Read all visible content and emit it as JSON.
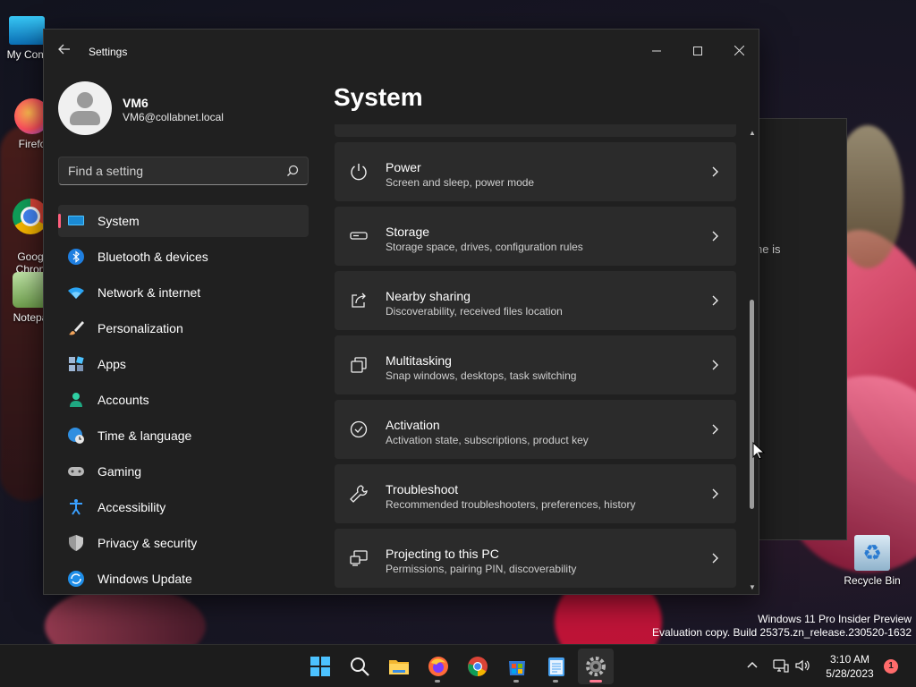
{
  "desktop": {
    "icons": [
      {
        "label": "My Com"
      },
      {
        "label": "Firefo"
      },
      {
        "label": "Goog\nChron"
      },
      {
        "label": "Notepa"
      },
      {
        "label": "Recycle Bin"
      }
    ],
    "background_window_partial_text": "ne is"
  },
  "window": {
    "title": "Settings",
    "controls": {
      "minimize": "—",
      "maximize": "☐",
      "close": "✕"
    }
  },
  "profile": {
    "name": "VM6",
    "email": "VM6@collabnet.local"
  },
  "search": {
    "placeholder": "Find a setting"
  },
  "nav": {
    "items": [
      {
        "label": "System",
        "icon": "monitor-icon",
        "active": true
      },
      {
        "label": "Bluetooth & devices",
        "icon": "bluetooth-icon"
      },
      {
        "label": "Network & internet",
        "icon": "wifi-icon"
      },
      {
        "label": "Personalization",
        "icon": "brush-icon"
      },
      {
        "label": "Apps",
        "icon": "apps-icon"
      },
      {
        "label": "Accounts",
        "icon": "person-icon"
      },
      {
        "label": "Time & language",
        "icon": "globe-clock-icon"
      },
      {
        "label": "Gaming",
        "icon": "gamepad-icon"
      },
      {
        "label": "Accessibility",
        "icon": "accessibility-icon"
      },
      {
        "label": "Privacy & security",
        "icon": "shield-icon"
      },
      {
        "label": "Windows Update",
        "icon": "update-icon"
      }
    ]
  },
  "page": {
    "title": "System",
    "cards": [
      {
        "title": "Power",
        "subtitle": "Screen and sleep, power mode",
        "icon": "power-icon"
      },
      {
        "title": "Storage",
        "subtitle": "Storage space, drives, configuration rules",
        "icon": "storage-icon"
      },
      {
        "title": "Nearby sharing",
        "subtitle": "Discoverability, received files location",
        "icon": "share-icon"
      },
      {
        "title": "Multitasking",
        "subtitle": "Snap windows, desktops, task switching",
        "icon": "multitasking-icon"
      },
      {
        "title": "Activation",
        "subtitle": "Activation state, subscriptions, product key",
        "icon": "check-circle-icon"
      },
      {
        "title": "Troubleshoot",
        "subtitle": "Recommended troubleshooters, preferences, history",
        "icon": "wrench-icon"
      },
      {
        "title": "Projecting to this PC",
        "subtitle": "Permissions, pairing PIN, discoverability",
        "icon": "projection-icon"
      }
    ]
  },
  "watermark": {
    "line1": "Windows 11 Pro Insider Preview",
    "line2": "Evaluation copy. Build 25375.zn_release.230520-1632"
  },
  "taskbar": {
    "apps": [
      "start-icon",
      "search-icon",
      "file-explorer-icon",
      "firefox-icon",
      "chrome-icon",
      "store-icon",
      "notepad-icon",
      "settings-icon"
    ],
    "time": "3:10 AM",
    "date": "5/28/2023",
    "notifications": "1"
  },
  "colors": {
    "accent": "#ff5f7e",
    "window_bg": "#202020",
    "card_bg": "#2b2b2b",
    "taskbar_bg": "#1c1c1c"
  }
}
